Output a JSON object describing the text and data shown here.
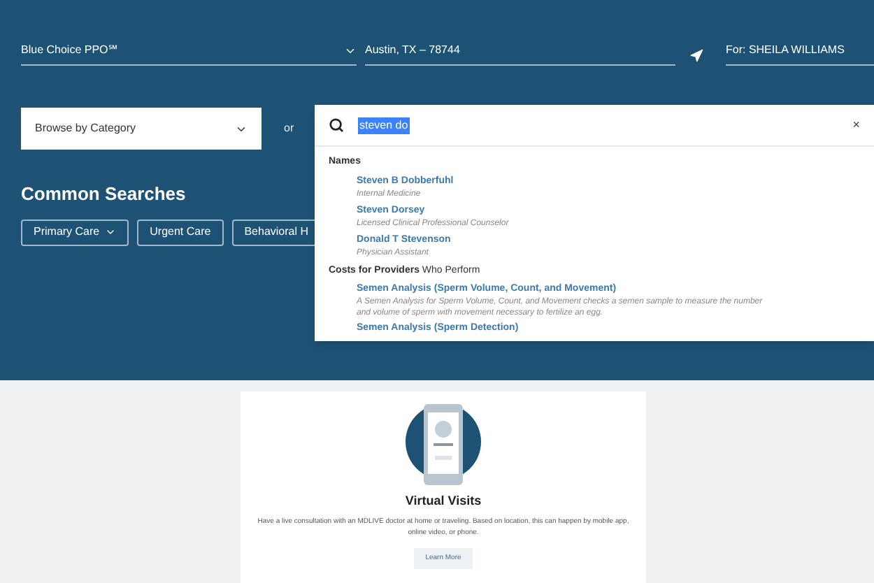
{
  "header": {
    "plan": "Blue Choice PPO℠",
    "location": "Austin, TX – 78744",
    "member": "For: SHEILA WILLIAMS"
  },
  "browse": {
    "placeholder": "Browse by Category"
  },
  "or_label": "or",
  "search": {
    "value": "steven do",
    "clear": "×"
  },
  "common_searches": {
    "title": "Common Searches",
    "chips": [
      {
        "label": "Primary Care",
        "kind": "dropdown"
      },
      {
        "label": "Urgent Care",
        "kind": "plain"
      },
      {
        "label": "Behavioral H",
        "kind": "plain"
      }
    ]
  },
  "suggestions": [
    {
      "heading": "Names",
      "items": [
        {
          "title": "Steven B Dobberfuhl",
          "subtitle": "Internal Medicine"
        },
        {
          "title": "Steven Dorsey",
          "subtitle": "Licensed Clinical Professional Counselor"
        },
        {
          "title": "Donald T Stevenson",
          "subtitle": "Physician Assistant"
        }
      ]
    },
    {
      "heading": "Costs for Providers",
      "heading_rest": " Who Perform",
      "items": [
        {
          "title": "Semen Analysis (Sperm Volume, Count, and Movement)",
          "description": "A Semen Analysis for Sperm Volume, Count, and Movement checks a semen sample to measure the number and volume of sperm with movement necessary to fertilize an egg."
        },
        {
          "title": "Semen Analysis (Sperm Detection)"
        }
      ]
    }
  ],
  "card": {
    "title": "Virtual Visits",
    "text": "Have a live consultation with an MDLIVE doctor at home or traveling. Based on location, this can happen by mobile app, online video, or phone.",
    "button": "Learn More"
  }
}
